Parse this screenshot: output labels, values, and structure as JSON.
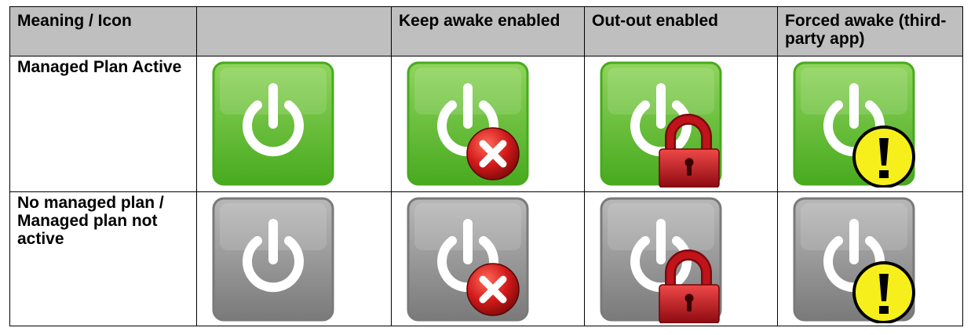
{
  "table": {
    "header": [
      "Meaning / Icon",
      "",
      "Keep awake enabled",
      "Out-out enabled",
      "Forced awake (third-party app)"
    ],
    "rows": [
      {
        "label": "Managed Plan Active",
        "color": "green",
        "icons": [
          "power-icon",
          "power-icon-error-overlay",
          "power-icon-lock-overlay",
          "power-icon-warning-overlay"
        ]
      },
      {
        "label": "No managed plan / Managed plan not active",
        "color": "grey",
        "icons": [
          "power-icon",
          "power-icon-error-overlay",
          "power-icon-lock-overlay",
          "power-icon-warning-overlay"
        ]
      }
    ]
  },
  "colors": {
    "header_bg": "#bfbfbf",
    "green_light": "#8fd45c",
    "green_dark": "#48aa1f",
    "grey_light": "#b8b8b8",
    "grey_dark": "#7a7a7a",
    "error_red": "#d11a1a",
    "lock_red": "#c0141a",
    "warning_yellow": "#f7ef1c"
  }
}
